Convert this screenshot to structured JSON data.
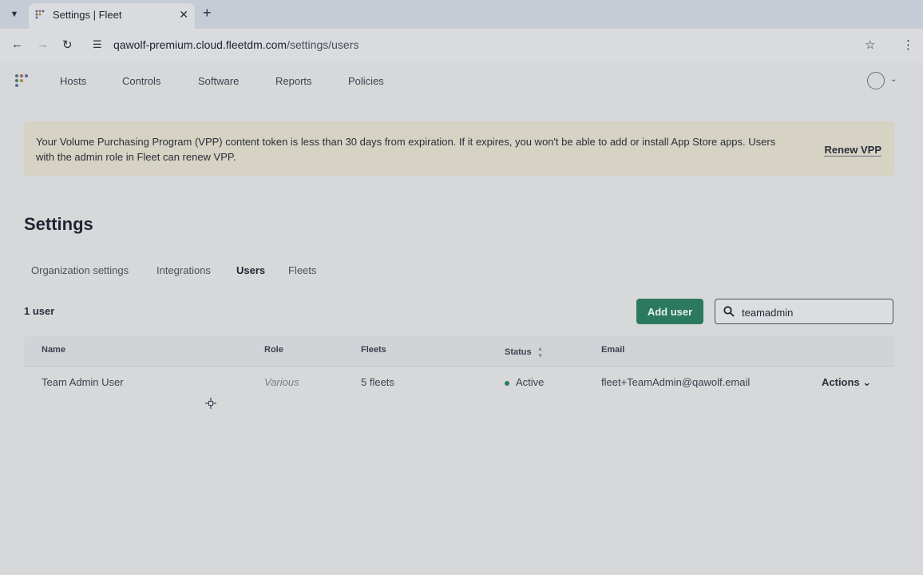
{
  "browser": {
    "tab_title": "Settings | Fleet",
    "url_host": "qawolf-premium.cloud.fleetdm.com",
    "url_path": "/settings/users"
  },
  "nav": {
    "items": [
      "Hosts",
      "Controls",
      "Software",
      "Reports",
      "Policies"
    ]
  },
  "banner": {
    "text": "Your Volume Purchasing Program (VPP) content token is less than 30 days from expiration. If it expires, you won't be able to add or install App Store apps. Users with the admin role in Fleet can renew VPP.",
    "action": "Renew VPP"
  },
  "page": {
    "title": "Settings",
    "tabs": [
      "Organization settings",
      "Integrations",
      "Users",
      "Fleets"
    ],
    "active_tab": "Users"
  },
  "users": {
    "count_label": "1 user",
    "add_button": "Add user",
    "search_value": "teamadmin",
    "columns": [
      "Name",
      "Role",
      "Fleets",
      "Status",
      "Email"
    ],
    "rows": [
      {
        "name": "Team Admin User",
        "role": "Various",
        "fleets": "5 fleets",
        "status": "Active",
        "email": "fleet+TeamAdmin@qawolf.email",
        "actions": "Actions"
      }
    ]
  },
  "colors": {
    "accent": "#2b7a5f",
    "banner_bg": "#d6d2c4"
  }
}
